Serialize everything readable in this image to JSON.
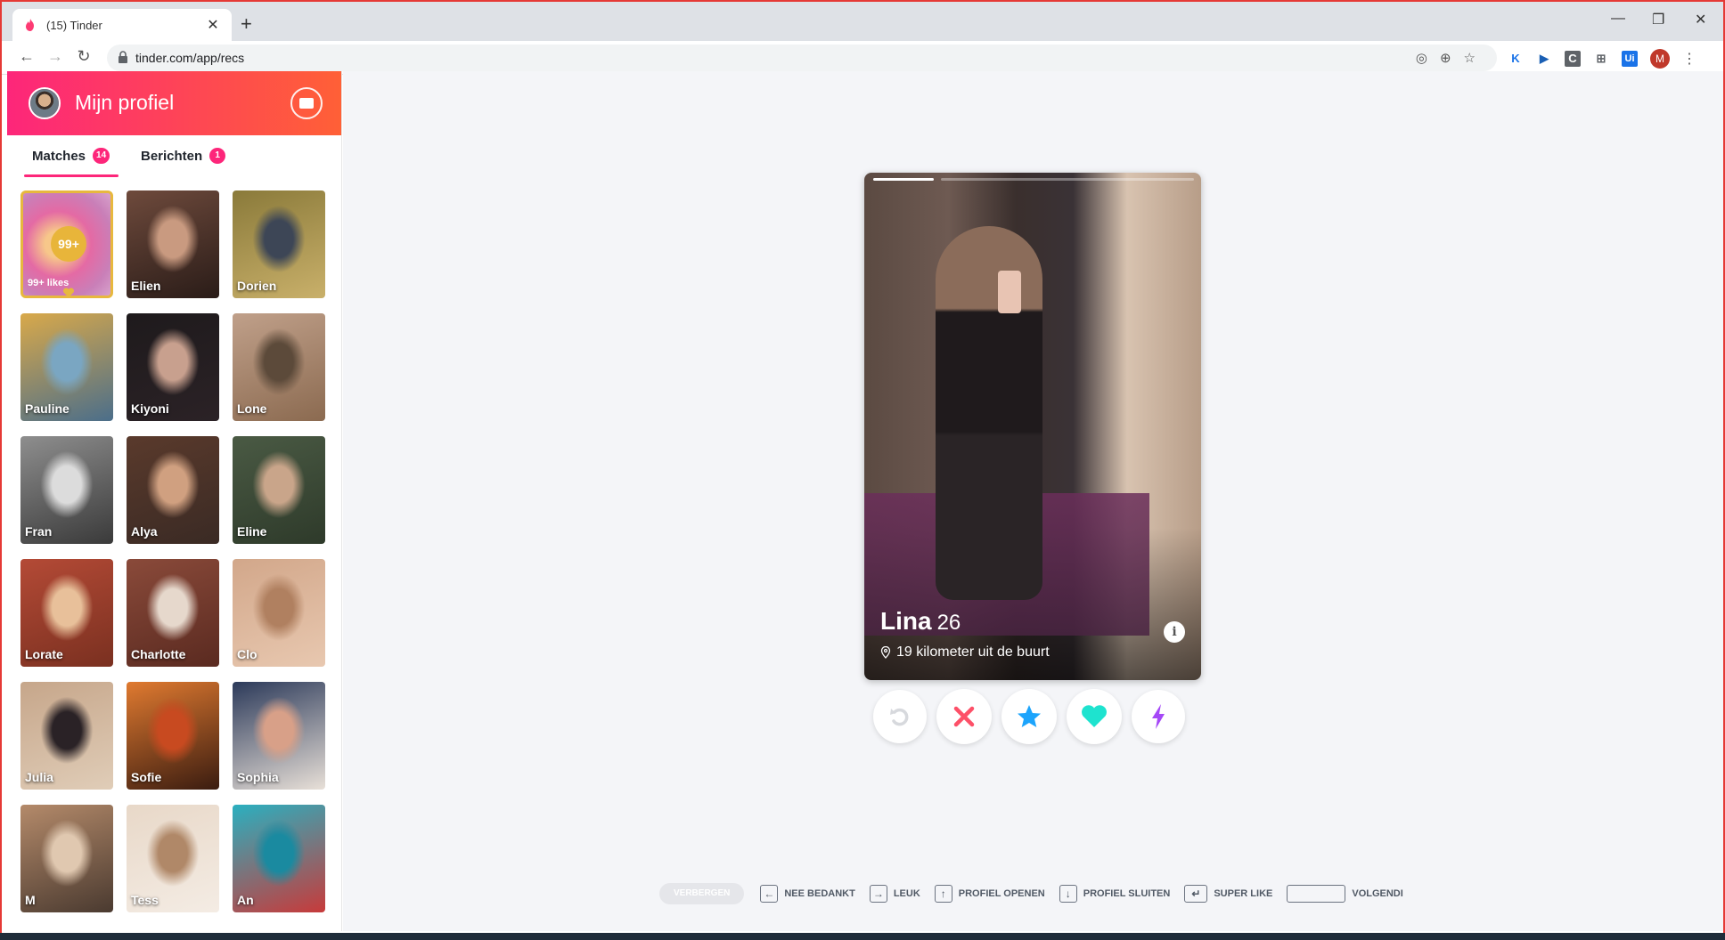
{
  "browser": {
    "tab_title": "(15) Tinder",
    "url": "tinder.com/app/recs",
    "avatar_initial": "M",
    "extensions": [
      "K",
      "▶",
      "C",
      "⊞",
      "Ui"
    ]
  },
  "sidebar": {
    "title": "Mijn profiel",
    "tabs": [
      {
        "label": "Matches",
        "badge": "14"
      },
      {
        "label": "Berichten",
        "badge": "1"
      }
    ],
    "likes_card": {
      "count": "99+",
      "label": "99+ likes"
    },
    "matches": [
      {
        "name": "Elien",
        "colors": [
          "#6e4a3c",
          "#c99a80",
          "#2a1c18"
        ]
      },
      {
        "name": "Dorien",
        "colors": [
          "#8a7a3a",
          "#3d4656",
          "#c9b06a"
        ]
      },
      {
        "name": "Pauline",
        "colors": [
          "#d9a94a",
          "#7aa6c2",
          "#4b6e8a"
        ]
      },
      {
        "name": "Kiyoni",
        "colors": [
          "#1e1a1c",
          "#c8a08e",
          "#2b2226"
        ]
      },
      {
        "name": "Lone",
        "colors": [
          "#c0a08a",
          "#5c4a3a",
          "#8b6a50"
        ]
      },
      {
        "name": "Fran",
        "colors": [
          "#8e8e8e",
          "#dcdcdc",
          "#3a3a3a"
        ]
      },
      {
        "name": "Alya",
        "colors": [
          "#5a3a2c",
          "#d0a080",
          "#3a2a24"
        ]
      },
      {
        "name": "Eline",
        "colors": [
          "#4a5a44",
          "#c9a58a",
          "#2e3a2a"
        ]
      },
      {
        "name": "Lorate",
        "colors": [
          "#b44a36",
          "#e8c09a",
          "#7a3020"
        ]
      },
      {
        "name": "Charlotte",
        "colors": [
          "#8a4a3a",
          "#e6d8cc",
          "#5a2a20"
        ]
      },
      {
        "name": "Clo",
        "colors": [
          "#d2a78a",
          "#b08060",
          "#e8c8b0"
        ]
      },
      {
        "name": "Julia",
        "colors": [
          "#c6a68a",
          "#2a2226",
          "#e0cdb8"
        ]
      },
      {
        "name": "Sofie",
        "colors": [
          "#e07a30",
          "#c84a20",
          "#3a1c10"
        ]
      },
      {
        "name": "Sophia",
        "colors": [
          "#2c3a5a",
          "#d8a088",
          "#e8e0d8"
        ]
      },
      {
        "name": "M",
        "colors": [
          "#b48a6a",
          "#e0c8b0",
          "#4a3a30"
        ]
      },
      {
        "name": "Tess",
        "colors": [
          "#e8d8c8",
          "#b08868",
          "#f4ece4"
        ]
      },
      {
        "name": "An",
        "colors": [
          "#2ab0c0",
          "#1a8aa0",
          "#c83a3a"
        ]
      }
    ]
  },
  "profile": {
    "name": "Lina",
    "age": "26",
    "distance": "19 kilometer uit de buurt",
    "info_symbol": "i",
    "photo_count": 2,
    "current_photo": 1
  },
  "actions": [
    {
      "name": "rewind",
      "color": "#d7d9dd"
    },
    {
      "name": "nope",
      "color": "#fd5068"
    },
    {
      "name": "super-like",
      "color": "#1ca4fc"
    },
    {
      "name": "like",
      "color": "#1ee3cf"
    },
    {
      "name": "boost",
      "color": "#a548f7"
    }
  ],
  "hints": {
    "hide_button": "VERBERGEN",
    "items": [
      {
        "key": "←",
        "label": "NEE BEDANKT"
      },
      {
        "key": "→",
        "label": "LEUK"
      },
      {
        "key": "↑",
        "label": "PROFIEL OPENEN"
      },
      {
        "key": "↓",
        "label": "PROFIEL SLUITEN"
      },
      {
        "key": "↵",
        "label": "SUPER LIKE"
      },
      {
        "key": "",
        "label": "VOLGENDI"
      }
    ]
  }
}
